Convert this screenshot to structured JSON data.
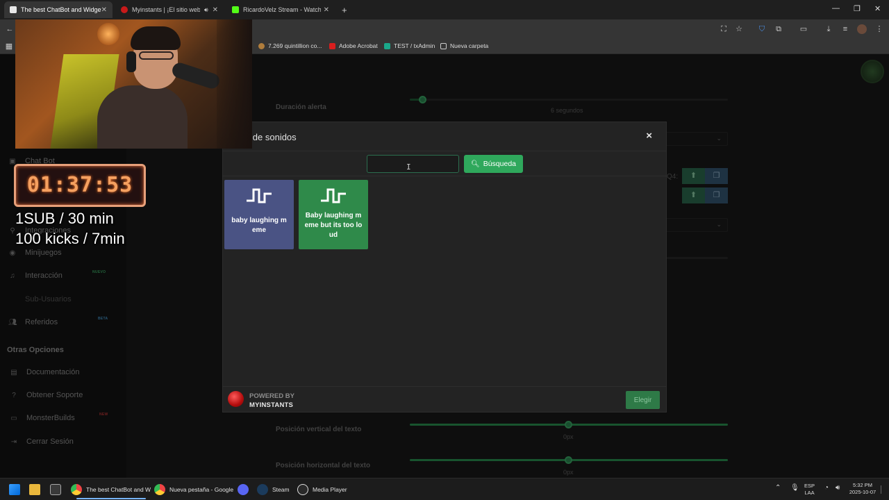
{
  "browser": {
    "tabs": [
      {
        "title": "The best ChatBot and Widgets",
        "active": true
      },
      {
        "title": "Myinstants | ¡El sitio web de",
        "active": false
      },
      {
        "title": "RicardoVelz Stream - Watch Liv",
        "active": false
      }
    ],
    "new_tab_label": "+",
    "bookmarks": [
      "7.269 quintillion co...",
      "Adobe Acrobat",
      "TEST / txAdmin",
      "Nueva carpeta"
    ]
  },
  "sidebar": {
    "items": [
      {
        "label": "Chat Bot",
        "icon": "robot-icon"
      },
      {
        "label": "Integraciones",
        "icon": "plug-icon"
      },
      {
        "label": "Minijuegos",
        "icon": "gamepad-icon"
      },
      {
        "label": "Interacción",
        "icon": "music-icon",
        "badge": "NUEVO"
      },
      {
        "label": "Sub-Usuarios",
        "icon": "users-icon"
      },
      {
        "label": "Referidos",
        "icon": "users-icon",
        "badge": "BETA"
      }
    ],
    "section_title": "Otras Opciones",
    "other_items": [
      {
        "label": "Documentación",
        "icon": "book-icon"
      },
      {
        "label": "Obtener Soporte",
        "icon": "question-icon"
      },
      {
        "label": "MonsterBuilds",
        "icon": "laptop-icon",
        "badge": "NEW"
      },
      {
        "label": "Cerrar Sesión",
        "icon": "logout-icon"
      }
    ]
  },
  "settings": {
    "duracion_label": "Duración alerta",
    "duracion_value": "6 segundos",
    "duracion_fraction": 0.04,
    "q4_label": "Q4:",
    "vertical_label": "Posición vertical del texto",
    "vertical_value": "0px",
    "horizontal_label": "Posición horizontal del texto",
    "horizontal_value": "0px"
  },
  "modal": {
    "title": "ría de sonidos",
    "close_label": "×",
    "search_value": "",
    "search_button": "Búsqueda",
    "sounds": [
      {
        "label": "baby laughing m eme",
        "color": "#4a5384"
      },
      {
        "label": "Baby laughing m eme but its too lo ud",
        "color": "#2f8a4a"
      }
    ],
    "footer": {
      "powered_by": "POWERED BY",
      "brand": "MYINSTANTS",
      "choose_button": "Elegir"
    }
  },
  "stream_overlay": {
    "timer": "01:37:53",
    "line1": "1SUB / 30 min",
    "line2": "100 kicks / 7min"
  },
  "taskbar": {
    "apps": [
      {
        "label": "The best ChatBot and W",
        "active": true
      },
      {
        "label": "Nueva pestaña - Google",
        "active": false
      },
      {
        "label": "",
        "active": false
      },
      {
        "label": "Steam",
        "active": false
      },
      {
        "label": "Media Player",
        "active": false
      }
    ],
    "lang_line1": "ESP",
    "lang_line2": "LAA",
    "time": "5:32 PM",
    "date": "2025-10-07"
  }
}
